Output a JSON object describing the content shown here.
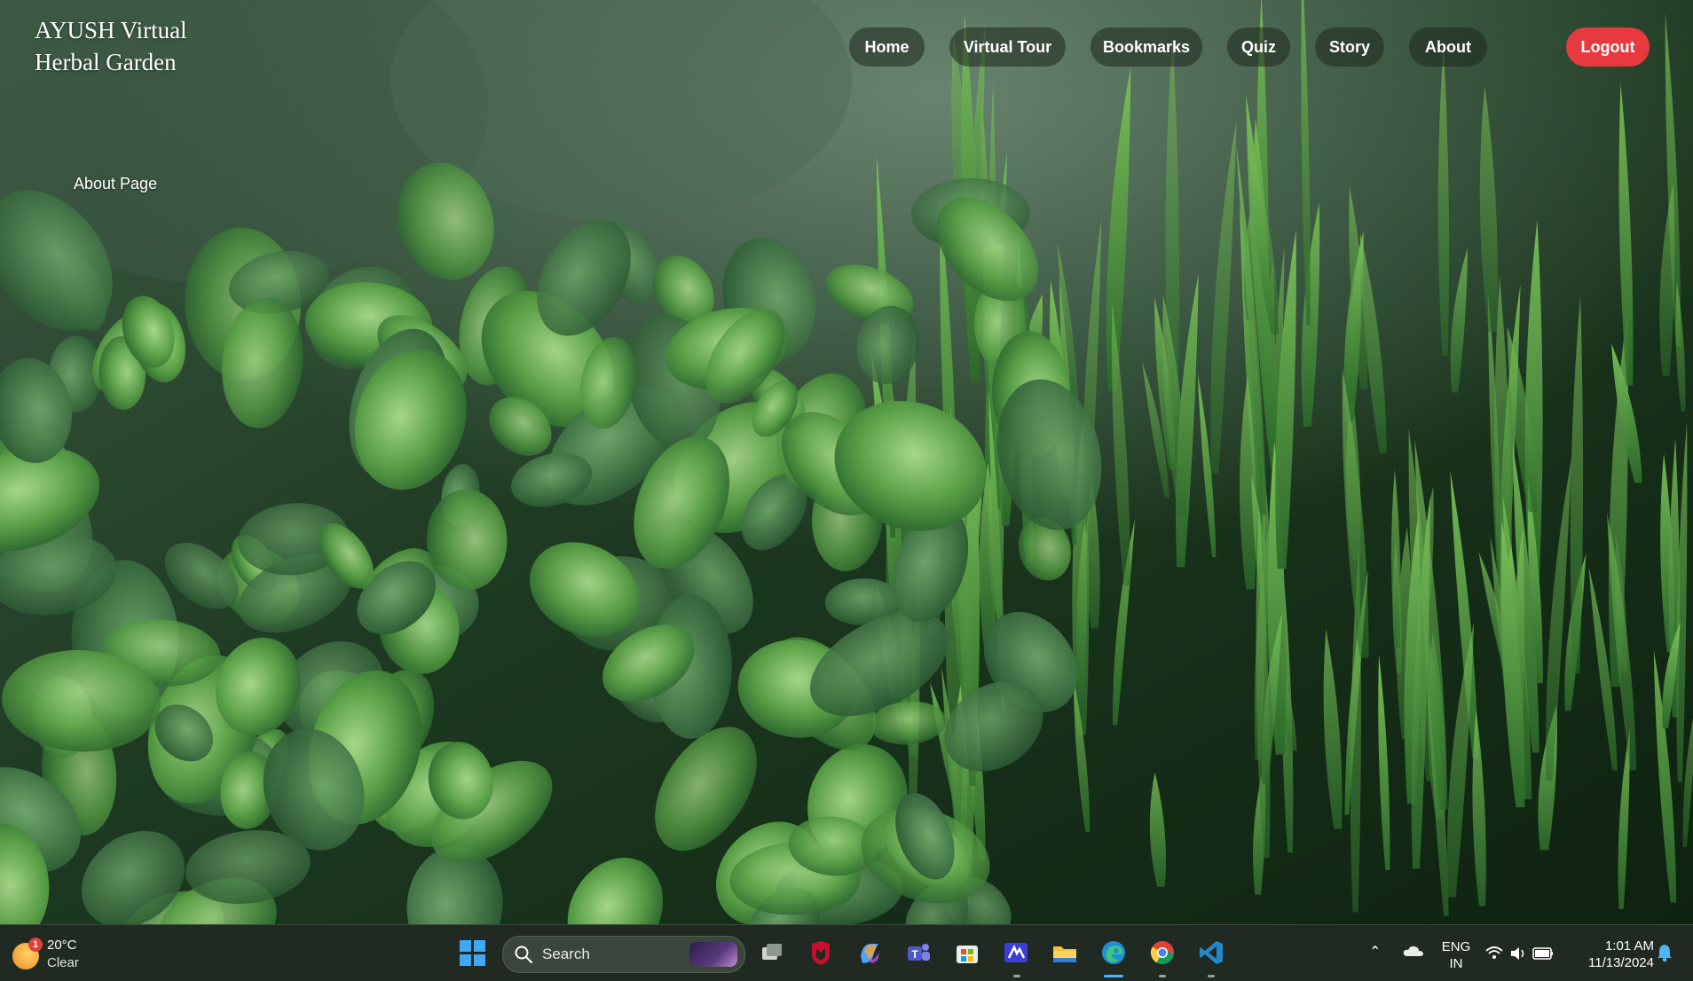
{
  "app": {
    "brand": "AYUSH Virtual Herbal Garden",
    "page_label": "About Page"
  },
  "nav": {
    "items": [
      {
        "label": "Home"
      },
      {
        "label": "Virtual Tour"
      },
      {
        "label": "Bookmarks"
      },
      {
        "label": "Quiz"
      },
      {
        "label": "Story"
      },
      {
        "label": "About"
      }
    ],
    "logout_label": "Logout",
    "logout_color": "#e8393f"
  },
  "background": {
    "description_icon": "herb-garden-photo",
    "colors": [
      "#1f4a22",
      "#3d7a3a",
      "#8cc46a",
      "#5aa846"
    ]
  },
  "taskbar": {
    "weather": {
      "temperature": "20°C",
      "condition": "Clear",
      "badge": "1"
    },
    "search_placeholder": "Search",
    "pinned_apps": [
      {
        "icon": "task-view-icon"
      },
      {
        "icon": "mcafee-icon"
      },
      {
        "icon": "copilot-icon"
      },
      {
        "icon": "teams-icon"
      },
      {
        "icon": "store-icon"
      },
      {
        "icon": "studio-icon"
      },
      {
        "icon": "file-explorer-icon"
      },
      {
        "icon": "edge-icon"
      },
      {
        "icon": "chrome-icon"
      },
      {
        "icon": "vscode-icon"
      }
    ],
    "language": {
      "line1": "ENG",
      "line2": "IN"
    },
    "clock": {
      "time": "1:01 AM",
      "date": "11/13/2024"
    }
  }
}
